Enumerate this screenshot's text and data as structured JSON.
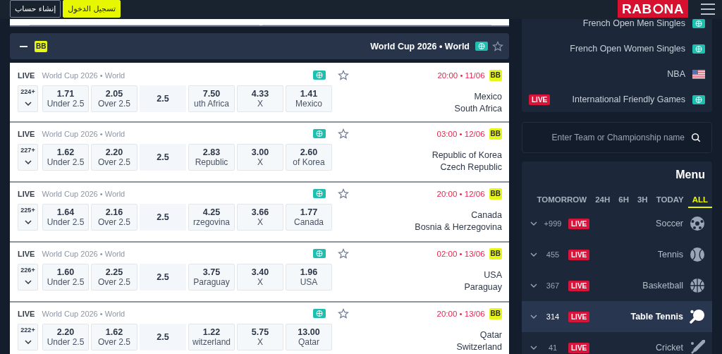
{
  "header": {
    "buttons": [
      {
        "label": "تسجيل الدخول",
        "kind": "primary"
      },
      {
        "label": "إنشاء حساب",
        "kind": "outline"
      }
    ],
    "logo": {
      "before": "RAB",
      "after": "NA"
    }
  },
  "league_bar": {
    "badge": "BB",
    "title": "World Cup 2026 • World"
  },
  "matches": [
    {
      "status": "LIVE",
      "league": "World Cup 2026 • World",
      "time": "20:00 • 11/06",
      "badge": "BB",
      "teams": [
        "Mexico",
        "South Africa"
      ],
      "markets": "224+",
      "odds": [
        {
          "kind": "odd",
          "value": "1.71",
          "label": "Under 2.5"
        },
        {
          "kind": "odd",
          "value": "2.05",
          "label": "Over 2.5"
        },
        {
          "kind": "line",
          "value": "2.5"
        },
        {
          "kind": "odd",
          "value": "7.50",
          "label": "uth Africa"
        },
        {
          "kind": "odd",
          "value": "4.33",
          "label": "X"
        },
        {
          "kind": "odd",
          "value": "1.41",
          "label": "Mexico"
        }
      ]
    },
    {
      "status": "LIVE",
      "league": "World Cup 2026 • World",
      "time": "03:00 • 12/06",
      "badge": "BB",
      "teams": [
        "Republic of Korea",
        "Czech Republic"
      ],
      "markets": "227+",
      "odds": [
        {
          "kind": "odd",
          "value": "1.62",
          "label": "Under 2.5"
        },
        {
          "kind": "odd",
          "value": "2.20",
          "label": "Over 2.5"
        },
        {
          "kind": "line",
          "value": "2.5"
        },
        {
          "kind": "odd",
          "value": "2.83",
          "label": "Republic"
        },
        {
          "kind": "odd",
          "value": "3.00",
          "label": "X"
        },
        {
          "kind": "odd",
          "value": "2.60",
          "label": "of Korea"
        }
      ]
    },
    {
      "status": "LIVE",
      "league": "World Cup 2026 • World",
      "time": "20:00 • 12/06",
      "badge": "BB",
      "teams": [
        "Canada",
        "Bosnia & Herzegovina"
      ],
      "markets": "225+",
      "odds": [
        {
          "kind": "odd",
          "value": "1.64",
          "label": "Under 2.5"
        },
        {
          "kind": "odd",
          "value": "2.16",
          "label": "Over 2.5"
        },
        {
          "kind": "line",
          "value": "2.5"
        },
        {
          "kind": "odd",
          "value": "4.25",
          "label": "rzegovina"
        },
        {
          "kind": "odd",
          "value": "3.66",
          "label": "X"
        },
        {
          "kind": "odd",
          "value": "1.77",
          "label": "Canada"
        }
      ]
    },
    {
      "status": "LIVE",
      "league": "World Cup 2026 • World",
      "time": "02:00 • 13/06",
      "badge": "BB",
      "teams": [
        "USA",
        "Paraguay"
      ],
      "markets": "226+",
      "odds": [
        {
          "kind": "odd",
          "value": "1.60",
          "label": "Under 2.5"
        },
        {
          "kind": "odd",
          "value": "2.25",
          "label": "Over 2.5"
        },
        {
          "kind": "line",
          "value": "2.5"
        },
        {
          "kind": "odd",
          "value": "3.75",
          "label": "Paraguay"
        },
        {
          "kind": "odd",
          "value": "3.40",
          "label": "X"
        },
        {
          "kind": "odd",
          "value": "1.96",
          "label": "USA"
        }
      ]
    },
    {
      "status": "LIVE",
      "league": "World Cup 2026 • World",
      "time": "20:00 • 13/06",
      "badge": "BB",
      "teams": [
        "Qatar",
        "Switzerland"
      ],
      "markets": "222+",
      "odds": [
        {
          "kind": "odd",
          "value": "2.20",
          "label": "Under 2.5"
        },
        {
          "kind": "odd",
          "value": "1.62",
          "label": "Over 2.5"
        },
        {
          "kind": "line",
          "value": "2.5"
        },
        {
          "kind": "odd",
          "value": "1.22",
          "label": "witzerland"
        },
        {
          "kind": "odd",
          "value": "5.75",
          "label": "X"
        },
        {
          "kind": "odd",
          "value": "13.00",
          "label": "Qatar"
        }
      ]
    }
  ],
  "top_leagues": [
    {
      "name": "French Open Men Singles",
      "kind": "world"
    },
    {
      "name": "French Open Women Singles",
      "kind": "world"
    },
    {
      "name": "NBA",
      "kind": "usa"
    },
    {
      "name": "International Friendly Games",
      "kind": "world",
      "live_badge": "LIVE"
    }
  ],
  "search": {
    "placeholder": "Enter Team or Championship name"
  },
  "menu": {
    "title": "Menu",
    "tabs": [
      {
        "label": "TOMORROW",
        "selected": false
      },
      {
        "label": "24H",
        "selected": false
      },
      {
        "label": "6H",
        "selected": false
      },
      {
        "label": "3H",
        "selected": false
      },
      {
        "label": "TODAY",
        "selected": false
      },
      {
        "label": "ALL",
        "selected": true
      }
    ],
    "sports": [
      {
        "kind": "soccer",
        "count": "+999",
        "live_badge": "LIVE",
        "name": "Soccer",
        "selected": false
      },
      {
        "kind": "tennis",
        "count": "455",
        "live_badge": "LIVE",
        "name": "Tennis",
        "selected": false
      },
      {
        "kind": "basketball",
        "count": "367",
        "live_badge": "LIVE",
        "name": "Basketball",
        "selected": false
      },
      {
        "kind": "table-tennis",
        "count": "314",
        "live_badge": "LIVE",
        "name": "Table Tennis",
        "selected": true
      },
      {
        "kind": "cricket",
        "count": "41",
        "live_badge": "LIVE",
        "name": "Cricket",
        "selected": false
      }
    ]
  }
}
